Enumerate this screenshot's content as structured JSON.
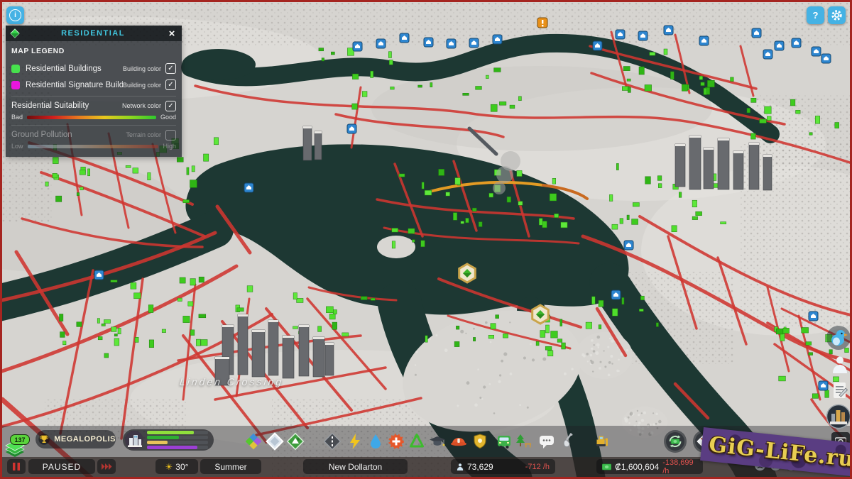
{
  "glyphs": {
    "info": "i",
    "help": "?",
    "close": "×",
    "check": "✓",
    "sun": "☀"
  },
  "info_panel": {
    "title": "RESIDENTIAL",
    "legend_title": "MAP LEGEND",
    "rows": [
      {
        "label": "Residential Buildings",
        "color_type": "Building color",
        "swatch": "#47e14d",
        "checked": true
      },
      {
        "label": "Residential Signature Buildings",
        "color_type": "Building color",
        "swatch": "#ea16df",
        "checked": true
      }
    ],
    "suitability": {
      "label": "Residential Suitability",
      "color_type": "Network color",
      "checked": true,
      "scale_min": "Bad",
      "scale_max": "Good"
    },
    "pollution": {
      "label": "Ground Pollution",
      "color_type": "Terrain color",
      "checked": false,
      "scale_min": "Low",
      "scale_max": "High"
    }
  },
  "map": {
    "area_label": "Linden Crossing"
  },
  "progression": {
    "milestone_level": "137",
    "milestone_name": "MEGALOPOLIS",
    "demand": [
      {
        "name": "demand-green-light",
        "color": "#8fdf3c",
        "pct": 77
      },
      {
        "name": "demand-green",
        "color": "#2fae33",
        "pct": 52
      },
      {
        "name": "demand-yellow",
        "color": "#e7c45a",
        "pct": 34
      },
      {
        "name": "demand-purple",
        "color": "#9b3fd4",
        "pct": 83
      }
    ]
  },
  "toolbar": {
    "tools": [
      "zoning",
      "areas",
      "landscaping",
      "roads",
      "electricity",
      "water-sewage",
      "healthcare",
      "garbage",
      "education",
      "fire-rescue",
      "police",
      "transportation",
      "parks-recreation",
      "communications",
      "terraforming",
      "bulldozer",
      "economy",
      "map-info"
    ]
  },
  "status_bar": {
    "speed_state": "PAUSED",
    "temperature": "30°",
    "season": "Summer",
    "city_name": "New Dollarton",
    "population": "73,629",
    "population_rate": "-712 /h",
    "treasury": "₡1,600,604",
    "treasury_rate": "-138,699 /h"
  },
  "watermark": {
    "text": "GiG-LiFe.ru"
  },
  "colors": {
    "accent_cyan": "#41c8e1",
    "residential_green": "#47e14d",
    "signature_magenta": "#ea16df",
    "road_red": "#cf3530",
    "water": "#1d3833",
    "negative_red": "#e0524e",
    "button_blue": "#45b2e4"
  }
}
